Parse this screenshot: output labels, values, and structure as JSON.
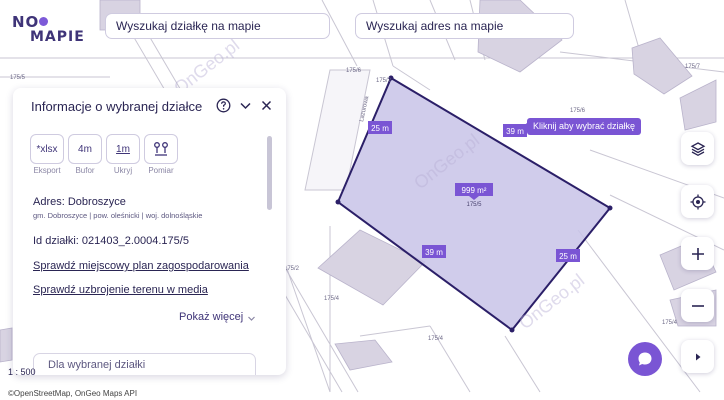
{
  "logo": {
    "top": "NO",
    "bottom": "MAPIE"
  },
  "search": {
    "plot_placeholder": "Wyszukaj działkę na mapie",
    "address_placeholder": "Wyszukaj adres na mapie"
  },
  "map": {
    "plot_area": "999 m²",
    "plot_number": "175/5",
    "edges": {
      "left": "25 m",
      "top": "39 m",
      "bottom": "39 m",
      "right": "25 m"
    },
    "parcel_labels": [
      "175/5",
      "175/6",
      "175/2",
      "175/7",
      "175/6",
      "175/4",
      "175/4",
      "175/2",
      "175/4"
    ],
    "street_label": "Lazurowa",
    "watermarks": [
      "OnGeo.pl",
      "OnGeo.pl",
      "OnGeo.pl"
    ],
    "colors": {
      "plot_fill": "#c8c3e7",
      "plot_stroke": "#2b1f68",
      "label": "#7a55d4",
      "building": "#d8d3e2"
    }
  },
  "tooltip": {
    "text": "Kliknij aby wybrać działkę"
  },
  "panel": {
    "title": "Informacje o wybranej działce",
    "tools": [
      {
        "icon": "*xlsx",
        "label": "Eksport"
      },
      {
        "icon": "4m",
        "label": "Bufor"
      },
      {
        "icon": "1m",
        "label": "Ukryj"
      },
      {
        "icon": "measure-icon",
        "label": "Pomiar"
      }
    ],
    "address_label": "Adres: Dobroszyce",
    "address_detail": "gm. Dobroszyce | pow. oleśnicki | woj. dolnośląskie",
    "plot_id": "Id działki: 021403_2.0004.175/5",
    "link_plan": "Sprawdź miejscowy plan zagospodarowania",
    "link_utilities": "Sprawdź uzbrojenie terenu w media",
    "show_more": "Pokaż więcej",
    "bottom_text": "Dla wybranej działki"
  },
  "scale": "1 : 500",
  "attribution": "©OpenStreetMap, OnGeo Maps API",
  "controls": {
    "layers": "layers-icon",
    "locate": "locate-icon",
    "zoom_in": "plus-icon",
    "zoom_out": "minus-icon",
    "play": "play-icon",
    "chat": "chat-icon"
  }
}
